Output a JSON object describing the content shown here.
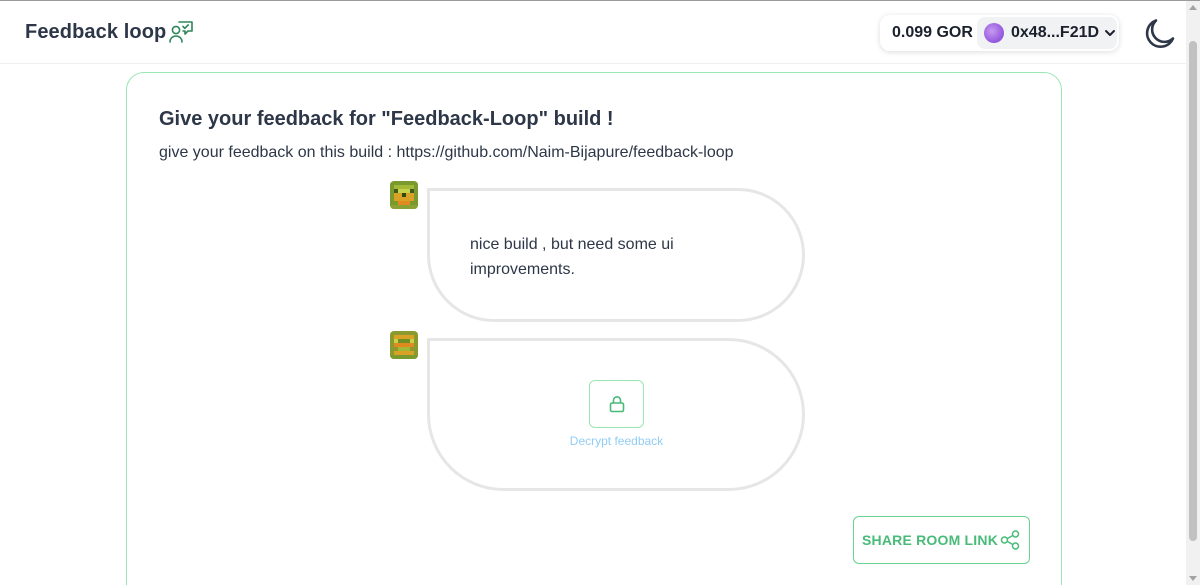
{
  "header": {
    "brand_title": "Feedback loop",
    "brand_icon": "feedback-people-icon",
    "wallet": {
      "balance": "0.099 GOR",
      "address": "0x48...F21D",
      "avatar_color": "#9a5fe0"
    },
    "theme_toggle_icon": "moon-icon"
  },
  "room": {
    "title": "Give your feedback for \"Feedback-Loop\" build !",
    "description": "give your feedback on this build : https://github.com/Naim-Bijapure/feedback-loop",
    "messages": [
      {
        "text": "nice build , but need some ui improvements.",
        "encrypted": false
      },
      {
        "text": "",
        "encrypted": true,
        "decrypt_label": "Decrypt feedback",
        "icon": "lock-icon"
      }
    ],
    "share_label": "SHARE ROOM LINK",
    "share_icon": "share-icon"
  },
  "colors": {
    "accent_green": "#48bb78",
    "card_border": "#9ae6b4",
    "decrypt_label": "#90cdf4",
    "text_dark": "#2d3748"
  }
}
